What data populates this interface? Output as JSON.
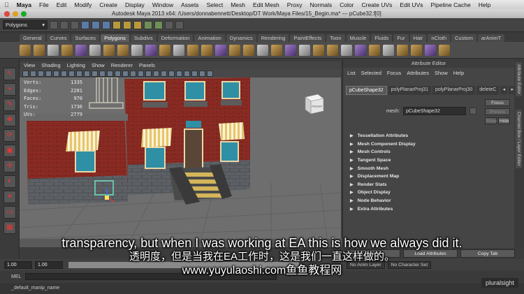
{
  "mac_menu": {
    "apple": "",
    "app": "Maya",
    "items": [
      "File",
      "Edit",
      "Modify",
      "Create",
      "Display",
      "Window",
      "Assets",
      "Select",
      "Mesh",
      "Edit Mesh",
      "Proxy",
      "Normals",
      "Color",
      "Create UVs",
      "Edit UVs",
      "Pipeline Cache",
      "Help"
    ]
  },
  "window_title": "Autodesk Maya 2013 x64: /Users/donnabennett/Desktop/DT Work/Maya Files/15_Begin.ma*  ---  pCube32.f[0]",
  "mode_select": "Polygons",
  "shelf_tabs": [
    "General",
    "Curves",
    "Surfaces",
    "Polygons",
    "Subdivs",
    "Deformation",
    "Animation",
    "Dynamics",
    "Rendering",
    "PaintEffects",
    "Toon",
    "Muscle",
    "Fluids",
    "Fur",
    "Hair",
    "nCloth",
    "Custom",
    "arAnimT"
  ],
  "panel_menu": [
    "View",
    "Shading",
    "Lighting",
    "Show",
    "Renderer",
    "Panels"
  ],
  "hud": [
    {
      "label": "Verts:",
      "value": "1335"
    },
    {
      "label": "Edges:",
      "value": "2281"
    },
    {
      "label": "Faces:",
      "value": "970"
    },
    {
      "label": "Tris:",
      "value": "1736"
    },
    {
      "label": "UVs:",
      "value": "2779"
    }
  ],
  "view_cube_label": "FRONT",
  "attribute_editor": {
    "title": "Attribute Editor",
    "menu": [
      "List",
      "Selected",
      "Focus",
      "Attributes",
      "Show",
      "Help"
    ],
    "tabs": [
      "pCubeShape32",
      "polyPlanarProj31",
      "polyPlanarProj30",
      "deleteC"
    ],
    "mesh_label": "mesh:",
    "mesh_value": "pCubeShape32",
    "focus_label": "Focus",
    "presets_label": "Presets",
    "show_label": "Show",
    "hide_label": "Hide",
    "sections": [
      "Tessellation Attributes",
      "Mesh Component Display",
      "Mesh Controls",
      "Tangent Space",
      "Smooth Mesh",
      "Displacement Map",
      "Render Stats",
      "Object Display",
      "Node Behavior",
      "Extra Attributes"
    ],
    "bottom_buttons": [
      "Select",
      "Load Attributes",
      "Copy Tab"
    ]
  },
  "side_tabs": [
    "Attribute Editor",
    "Channel Box / Layer Editor"
  ],
  "range_bar": {
    "start": "1.00",
    "current": "1.00",
    "anim_layer": "No Anim Layer",
    "char_set": "No Character Set"
  },
  "cmd_label": "MEL",
  "help_line": "_default_manip_name",
  "watermark": "pluralsight",
  "subtitles": {
    "en": "transparency, but when I was working at EA this is how we always did it.",
    "cn": "透明度，但是当我在EA工作时，这是我们一直这样做的。",
    "url": "www.yuyulaoshi.com鱼鱼教程网"
  }
}
